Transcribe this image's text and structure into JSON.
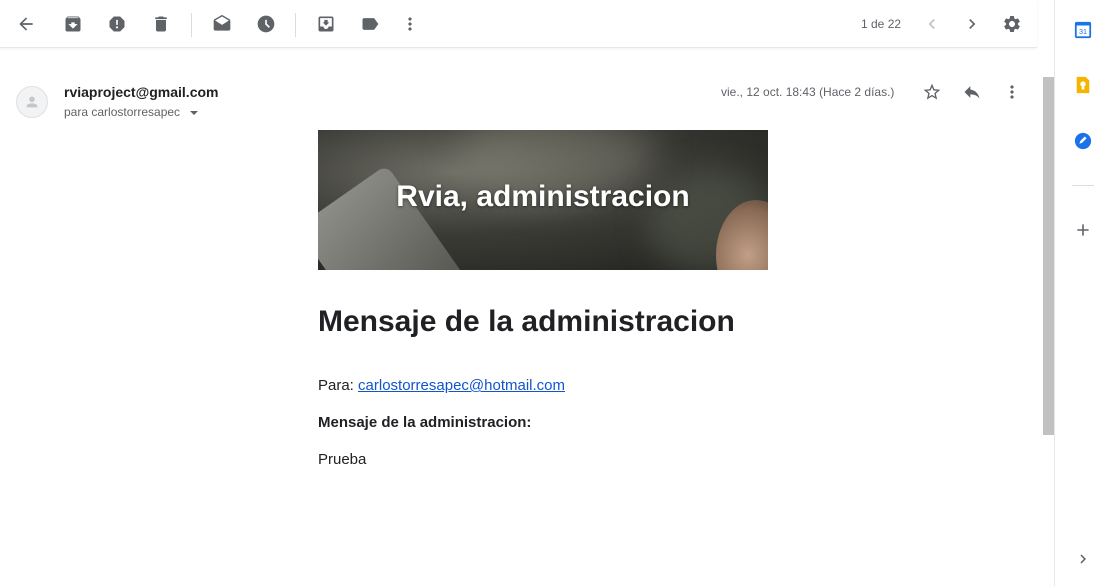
{
  "toolbar": {
    "icons": [
      "back-arrow-icon",
      "archive-icon",
      "report-spam-icon",
      "delete-icon",
      "mark-unread-icon",
      "snooze-icon",
      "move-to-icon",
      "label-icon",
      "more-vert-icon"
    ],
    "pager": "1 de 22"
  },
  "message": {
    "sender": "rviaproject@gmail.com",
    "recipient": "para carlostorresapec",
    "date": "vie., 12 oct. 18:43 (Hace 2 días.)"
  },
  "email_body": {
    "banner_title": "Rvia, administracion",
    "heading": "Mensaje de la administracion",
    "para_label": "Para: ",
    "para_email": "carlostorresapec@hotmail.com",
    "message_label": "Mensaje de la administracion:",
    "message_text": "Prueba"
  },
  "side_panel": {
    "calendar_day": "31",
    "icons": [
      "calendar-icon",
      "keep-icon",
      "tasks-icon",
      "add-icon",
      "expand-icon"
    ]
  },
  "colors": {
    "accent_blue": "#1a73e8",
    "keep_yellow": "#f4b400",
    "link": "#1155cc"
  }
}
